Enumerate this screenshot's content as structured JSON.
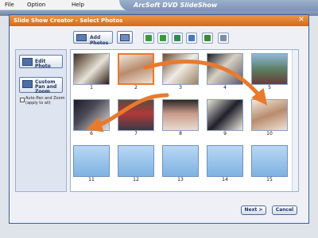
{
  "menu": {
    "file": "File",
    "option": "Option",
    "help": "Help"
  },
  "app": {
    "title": "ArcSoft DVD SlideShow"
  },
  "dialog": {
    "title": "Slide Show Creator - Select Photos",
    "close_glyph": "✕",
    "toolbar": {
      "add_photos": "Add Photos"
    },
    "left": {
      "edit_photo": "Edit Photo",
      "custom_pan_zoom": "Custom Pan and Zoom",
      "auto_pan_zoom": "Auto-Pan and Zoom (apply to all)"
    },
    "photos": [
      {
        "num": "1"
      },
      {
        "num": "2"
      },
      {
        "num": "3"
      },
      {
        "num": "4"
      },
      {
        "num": "5"
      },
      {
        "num": "6"
      },
      {
        "num": "7"
      },
      {
        "num": "8"
      },
      {
        "num": "9"
      },
      {
        "num": "10"
      },
      {
        "num": "11"
      },
      {
        "num": "12"
      },
      {
        "num": "13"
      },
      {
        "num": "14"
      },
      {
        "num": "15"
      }
    ],
    "buttons": {
      "next": "Next >",
      "cancel": "Cancel"
    }
  },
  "colors": {
    "accent": "#e07b2c",
    "title_bar": "#d8782e",
    "frame": "#3a5f9a"
  }
}
